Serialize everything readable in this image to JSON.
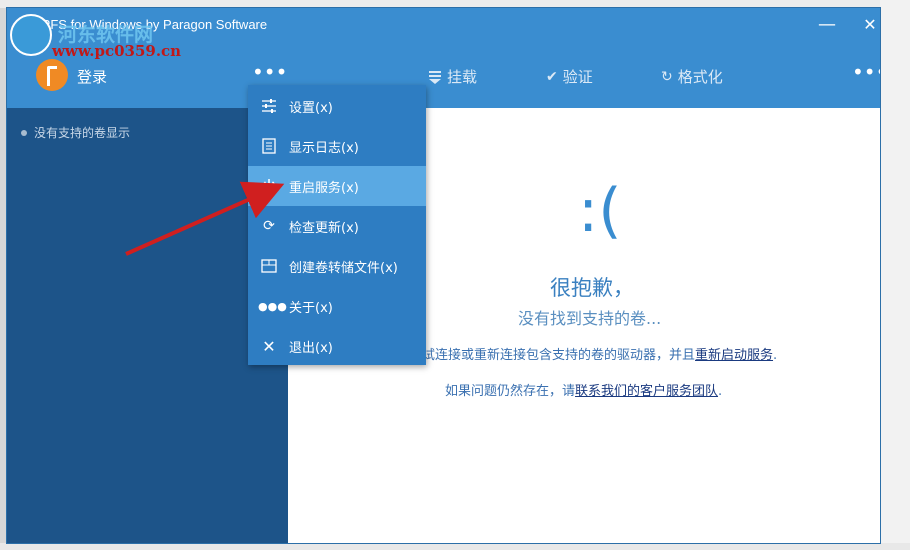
{
  "window": {
    "title": "APFS for Windows by Paragon Software",
    "minimize_glyph": "—",
    "close_glyph": "✕"
  },
  "toolbar": {
    "login_label": "登录",
    "mount_label": "挂载",
    "verify_label": "验证",
    "format_label": "格式化",
    "more_glyph": "•••"
  },
  "sidebar": {
    "empty_label": "没有支持的卷显示"
  },
  "menu": {
    "items": [
      {
        "label": "设置(x)",
        "icon": "sliders-icon"
      },
      {
        "label": "显示日志(x)",
        "icon": "log-icon"
      },
      {
        "label": "重启服务(x)",
        "icon": "power-icon"
      },
      {
        "label": "检查更新(x)",
        "icon": "refresh-icon"
      },
      {
        "label": "创建卷转储文件(x)",
        "icon": "dump-icon"
      },
      {
        "label": "关于(x)",
        "icon": "dots-icon"
      },
      {
        "label": "退出(x)",
        "icon": "close-icon"
      }
    ],
    "active_index": 2
  },
  "main": {
    "face": ":(",
    "sorry": "很抱歉，",
    "no_volume": "没有找到支持的卷...",
    "hint1_prefix": "试连接或重新连接包含支持的卷的驱动器，并且",
    "hint1_link": "重新启动服务",
    "hint1_suffix": ".",
    "hint2_prefix": "如果问题仍然存在，请",
    "hint2_link": "联系我们的客户服务团队",
    "hint2_suffix": "."
  },
  "watermark": {
    "site": "www.pc0359.cn",
    "brand": "河东软件网"
  },
  "colors": {
    "titlebar": "#3a8dd0",
    "sidebar": "#1d5489",
    "menu": "#2e7dc2",
    "menu_active": "#5aa9e3",
    "arrow": "#d01f1f"
  }
}
